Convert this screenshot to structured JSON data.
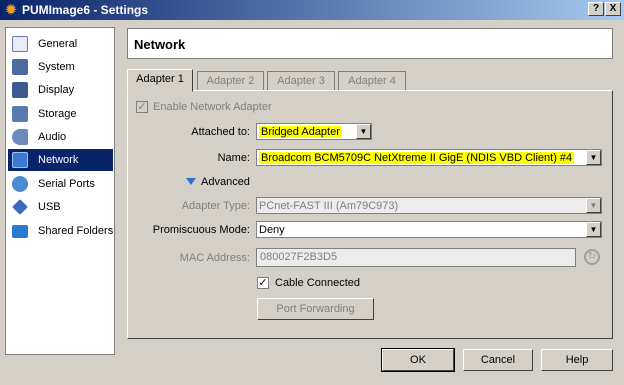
{
  "window": {
    "title": "PUMImage6 - Settings",
    "help": "?",
    "close": "X"
  },
  "sidebar": {
    "items": [
      {
        "label": "General",
        "icon": "general-icon",
        "color": "#6a7aa8"
      },
      {
        "label": "System",
        "icon": "system-icon",
        "color": "#4a6aa0"
      },
      {
        "label": "Display",
        "icon": "display-icon",
        "color": "#3a5a90"
      },
      {
        "label": "Storage",
        "icon": "storage-icon",
        "color": "#5a7ab0"
      },
      {
        "label": "Audio",
        "icon": "audio-icon",
        "color": "#6a8ac0"
      },
      {
        "label": "Network",
        "icon": "network-icon",
        "color": "#3a7ad0",
        "selected": true
      },
      {
        "label": "Serial Ports",
        "icon": "serial-ports-icon",
        "color": "#4a8ad0"
      },
      {
        "label": "USB",
        "icon": "usb-icon",
        "color": "#3a6ac0"
      },
      {
        "label": "Shared Folders",
        "icon": "shared-folders-icon",
        "color": "#2a7ad0"
      }
    ]
  },
  "section": {
    "title": "Network"
  },
  "tabs": [
    "Adapter 1",
    "Adapter 2",
    "Adapter 3",
    "Adapter 4"
  ],
  "adapter": {
    "enable_label": "Enable Network Adapter",
    "attached_label": "Attached to:",
    "attached_value": "Bridged Adapter",
    "name_label": "Name:",
    "name_value": "Broadcom BCM5709C NetXtreme II GigE (NDIS VBD Client) #4",
    "advanced_label": "Advanced",
    "adapter_type_label": "Adapter Type:",
    "adapter_type_value": "PCnet-FAST III (Am79C973)",
    "promiscuous_label": "Promiscuous Mode:",
    "promiscuous_value": "Deny",
    "mac_label": "MAC Address:",
    "mac_value": "080027F2B3D5",
    "cable_label": "Cable Connected",
    "port_forwarding_label": "Port Forwarding"
  },
  "buttons": {
    "ok": "OK",
    "cancel": "Cancel",
    "help": "Help"
  }
}
